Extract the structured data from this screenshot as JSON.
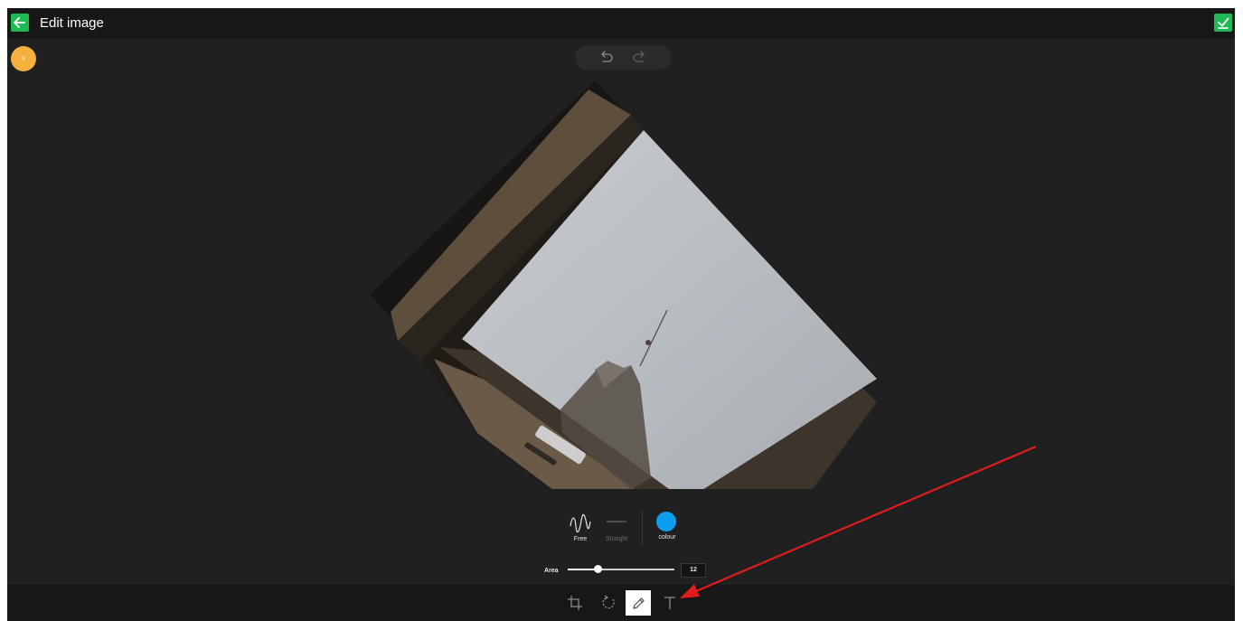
{
  "header": {
    "title": "Edit image",
    "back_icon": "arrow-left-icon",
    "confirm_icon": "check-icon",
    "accent_color": "#1db954"
  },
  "user": {
    "avatar_initial": "s",
    "avatar_color": "#f5b13d"
  },
  "history": {
    "undo_icon": "undo-icon",
    "redo_icon": "redo-icon"
  },
  "draw_panel": {
    "line_types": [
      {
        "label": "Free",
        "icon": "squiggle-icon",
        "selected": true
      },
      {
        "label": "Straight",
        "icon": "straight-line-icon",
        "selected": false
      }
    ],
    "colour_label": "colour",
    "colour_value": "#0d9ef0",
    "area_label": "Area",
    "area_value": "12",
    "area_fraction": 0.28
  },
  "bottom_toolbar": {
    "tools": [
      {
        "name": "crop",
        "icon": "crop-icon",
        "active": false
      },
      {
        "name": "rotate",
        "icon": "rotate-icon",
        "active": false
      },
      {
        "name": "draw",
        "icon": "pencil-icon",
        "active": true
      },
      {
        "name": "text",
        "icon": "text-icon",
        "active": false
      }
    ]
  },
  "annotation": {
    "arrow_color": "#e01c1c"
  }
}
